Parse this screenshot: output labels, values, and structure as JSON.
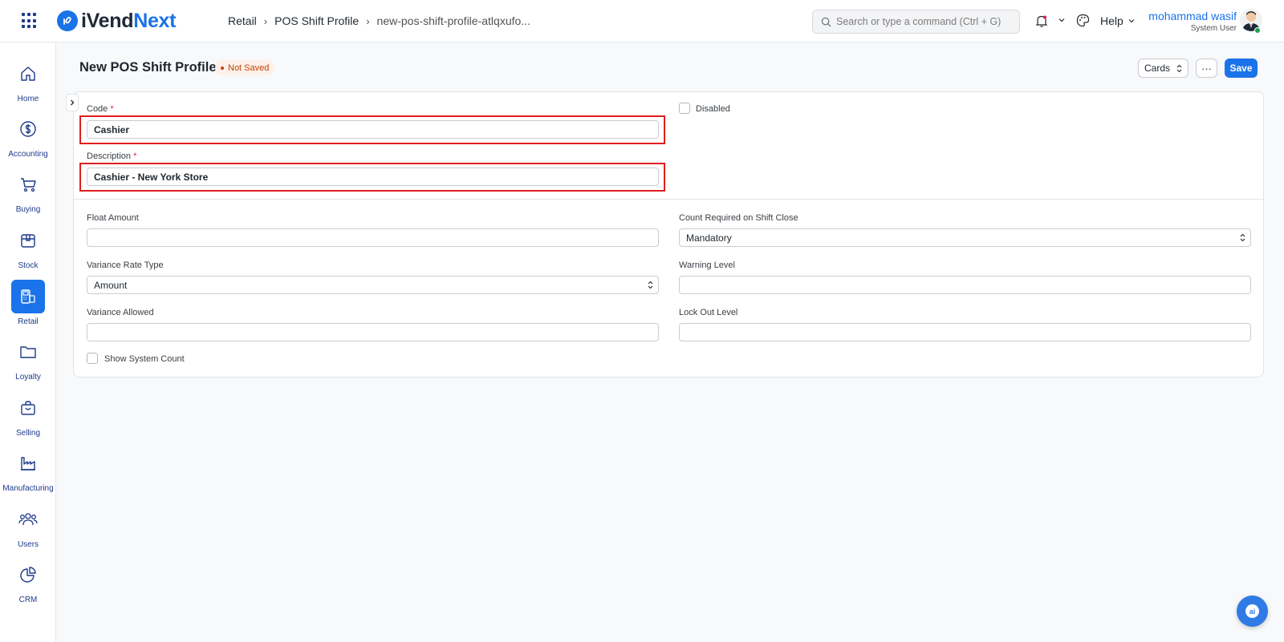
{
  "app": {
    "brand_prefix": "iVend",
    "brand_suffix": "Next"
  },
  "breadcrumb": [
    "Retail",
    "POS Shift Profile",
    "new-pos-shift-profile-atlqxufo..."
  ],
  "search": {
    "placeholder": "Search or type a command (Ctrl + G)"
  },
  "header": {
    "help_label": "Help"
  },
  "user": {
    "name": "mohammad wasif",
    "role": "System User"
  },
  "sidebar": {
    "items": [
      {
        "label": "Home",
        "icon": "home-icon",
        "active": false
      },
      {
        "label": "Accounting",
        "icon": "dollar-icon",
        "active": false
      },
      {
        "label": "Buying",
        "icon": "cart-icon",
        "active": false
      },
      {
        "label": "Stock",
        "icon": "box-icon",
        "active": false
      },
      {
        "label": "Retail",
        "icon": "pos-terminal-icon",
        "active": true
      },
      {
        "label": "Loyalty",
        "icon": "folder-icon",
        "active": false
      },
      {
        "label": "Selling",
        "icon": "shopping-bag-icon",
        "active": false
      },
      {
        "label": "Manufacturing",
        "icon": "factory-icon",
        "active": false
      },
      {
        "label": "Users",
        "icon": "users-icon",
        "active": false
      },
      {
        "label": "CRM",
        "icon": "pie-chart-icon",
        "active": false
      }
    ]
  },
  "page": {
    "title": "New POS Shift Profile",
    "status": "Not Saved",
    "view_label": "Cards",
    "more_label": "···",
    "save_label": "Save"
  },
  "form": {
    "code": {
      "label": "Code",
      "required_mark": "*",
      "value": "Cashier"
    },
    "description": {
      "label": "Description",
      "required_mark": "*",
      "value": "Cashier - New York Store"
    },
    "disabled": {
      "label": "Disabled",
      "checked": false
    },
    "float_amount": {
      "label": "Float Amount",
      "value": ""
    },
    "count_required": {
      "label": "Count Required on Shift Close",
      "value": "Mandatory"
    },
    "variance_rate_type": {
      "label": "Variance Rate Type",
      "value": "Amount"
    },
    "warning_level": {
      "label": "Warning Level",
      "value": ""
    },
    "variance_allowed": {
      "label": "Variance Allowed",
      "value": ""
    },
    "lock_out_level": {
      "label": "Lock Out Level",
      "value": ""
    },
    "show_system_count": {
      "label": "Show System Count",
      "checked": false
    }
  },
  "fab": {
    "label": "ai"
  },
  "colors": {
    "accent": "#1a73e8",
    "highlight": "#e11d1d",
    "status": "#c2410c"
  }
}
